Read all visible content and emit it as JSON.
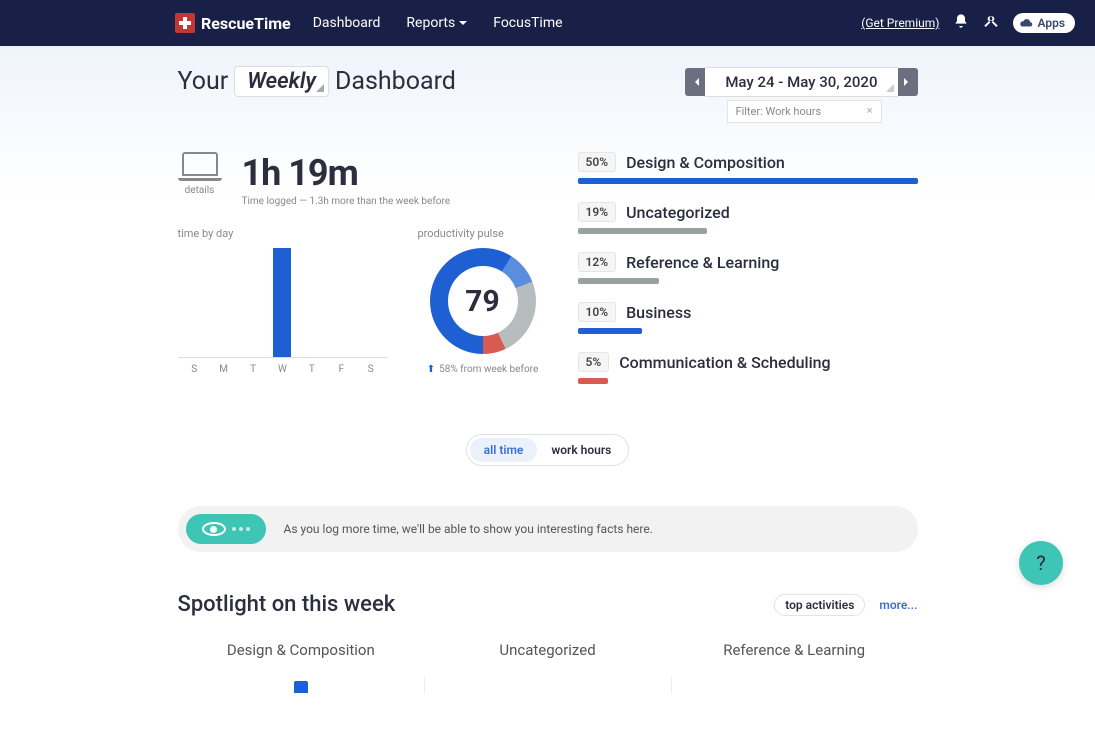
{
  "nav": {
    "brand": "RescueTime",
    "links": {
      "dashboard": "Dashboard",
      "reports": "Reports",
      "focustime": "FocusTime"
    },
    "get_premium": "(Get Premium)",
    "apps": "Apps"
  },
  "header": {
    "title_prefix": "Your",
    "title_select": "Weekly",
    "title_suffix": "Dashboard",
    "date_range": "May 24 - May 30, 2020",
    "filter": "Filter: Work hours"
  },
  "summary": {
    "details_label": "details",
    "time_logged": "1h 19m",
    "subtext": "Time logged — 1.3h more than the week before"
  },
  "chart_data": {
    "time_by_day": {
      "type": "bar",
      "label": "time by day",
      "categories": [
        "S",
        "M",
        "T",
        "W",
        "T",
        "F",
        "S"
      ],
      "values": [
        0,
        0,
        0,
        100,
        0,
        0,
        0
      ]
    },
    "pulse": {
      "type": "pie",
      "label": "productivity pulse",
      "center_value": "79",
      "segments": [
        {
          "color": "#1f5fd4",
          "pct": 59
        },
        {
          "color": "#5a8edc",
          "pct": 10
        },
        {
          "color": "#b7bdbf",
          "pct": 24
        },
        {
          "color": "#d85b52",
          "pct": 7
        }
      ],
      "subtext": "58% from week before"
    }
  },
  "categories": [
    {
      "pct": "50%",
      "name": "Design & Composition",
      "width": 100,
      "color": "#1f5fd4"
    },
    {
      "pct": "19%",
      "name": "Uncategorized",
      "width": 38,
      "color": "#9aa1a3"
    },
    {
      "pct": "12%",
      "name": "Reference & Learning",
      "width": 24,
      "color": "#9aa1a3"
    },
    {
      "pct": "10%",
      "name": "Business",
      "width": 19,
      "color": "#1f5fd4"
    },
    {
      "pct": "5%",
      "name": "Communication & Scheduling",
      "width": 9,
      "color": "#d85b52"
    }
  ],
  "toggle": {
    "all_time": "all time",
    "work_hours": "work hours"
  },
  "banner": {
    "text": "As you log more time, we'll be able to show you interesting facts here."
  },
  "spotlight": {
    "title": "Spotlight on this week",
    "top_activities": "top activities",
    "more": "more...",
    "cats": [
      "Design & Composition",
      "Uncategorized",
      "Reference & Learning"
    ]
  },
  "help": "?"
}
